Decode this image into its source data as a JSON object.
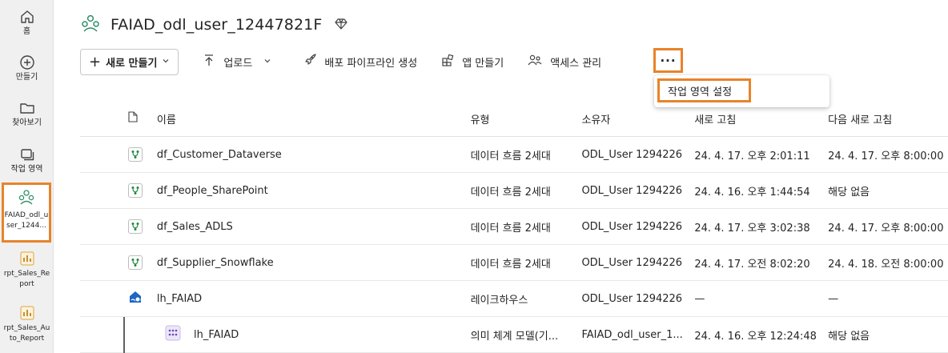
{
  "rail": {
    "home": "홈",
    "create": "만들기",
    "browse": "찾아보기",
    "workspaces": "작업 영역",
    "active_workspace": "FAIAD_odl_user_1244...",
    "report1": "rpt_Sales_Report",
    "report2": "rpt_Sales_Auto_Report"
  },
  "header": {
    "title": "FAIAD_odl_user_12447821F"
  },
  "toolbar": {
    "new_label": "새로 만들기",
    "upload_label": "업로드",
    "pipeline_label": "배포 파이프라인 생성",
    "app_label": "앱 만들기",
    "access_label": "액세스 관리",
    "more_label": "···"
  },
  "menu": {
    "workspace_settings": "작업 영역 설정"
  },
  "table": {
    "headers": {
      "name": "이름",
      "type": "유형",
      "owner": "소유자",
      "refreshed": "새로 고침",
      "next_refresh": "다음 새로 고침"
    },
    "rows": [
      {
        "name": "df_Customer_Dataverse",
        "type": "데이터 흐름 2세대",
        "owner": "ODL_User 1294226",
        "refreshed": "24. 4. 17. 오후 2:01:11",
        "next": "24. 4. 17. 오후 8:00:00",
        "icon": "dataflow-icon"
      },
      {
        "name": "df_People_SharePoint",
        "type": "데이터 흐름 2세대",
        "owner": "ODL_User 1294226",
        "refreshed": "24. 4. 16. 오후 1:44:54",
        "next": "해당 없음",
        "icon": "dataflow-icon"
      },
      {
        "name": "df_Sales_ADLS",
        "type": "데이터 흐름 2세대",
        "owner": "ODL_User 1294226",
        "refreshed": "24. 4. 17. 오후 3:02:38",
        "next": "24. 4. 17. 오후 8:00:00",
        "icon": "dataflow-icon"
      },
      {
        "name": "df_Supplier_Snowflake",
        "type": "데이터 흐름 2세대",
        "owner": "ODL_User 1294226",
        "refreshed": "24. 4. 17. 오전 8:02:20",
        "next": "24. 4. 18. 오전 8:00:00",
        "icon": "dataflow-icon"
      },
      {
        "name": "lh_FAIAD",
        "type": "레이크하우스",
        "owner": "ODL_User 1294226",
        "refreshed": "—",
        "next": "—",
        "icon": "lakehouse-icon"
      },
      {
        "name": "lh_FAIAD",
        "type": "의미 체계 모델(기...",
        "owner": "FAIAD_odl_user_1...",
        "refreshed": "24. 4. 16. 오후 12:24:48",
        "next": "해당 없음",
        "icon": "semantic-model-icon"
      }
    ]
  },
  "colors": {
    "highlight": "#e8832a",
    "dataflow_green": "#1d8a3c",
    "lakehouse_blue": "#1c66c4",
    "semantic_purple": "#6b47b8"
  }
}
